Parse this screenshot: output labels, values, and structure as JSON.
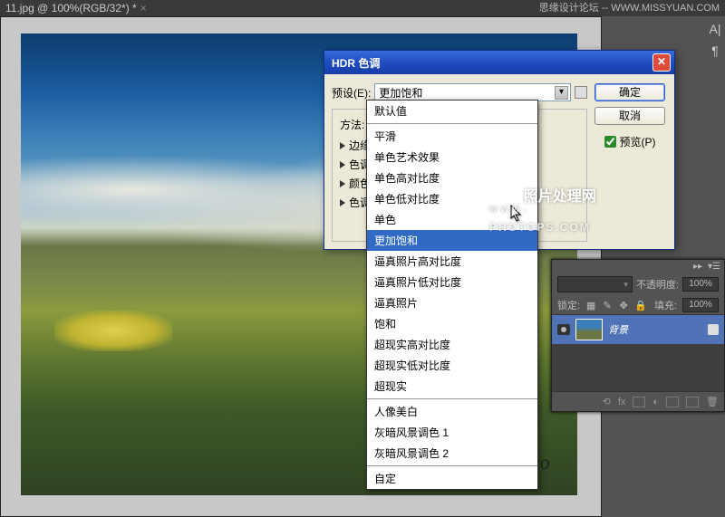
{
  "header_site": "思缘设计论坛 -- WWW.MISSYUAN.COM",
  "tab": {
    "title": "11.jpg @ 100%(RGB/32*) *",
    "close": "×"
  },
  "rail": {
    "a": "A|",
    "p": "¶"
  },
  "dialog": {
    "title": "HDR 色调",
    "preset_label": "预设(E):",
    "preset_value": "更加饱和",
    "method_label": "方法:",
    "sections": [
      "边缘",
      "色调",
      "颜色",
      "色调"
    ],
    "ok": "确定",
    "cancel": "取消",
    "preview": "预览(P)"
  },
  "dropdown": {
    "items_top": [
      "默认值"
    ],
    "items_mid": [
      "平滑",
      "单色艺术效果",
      "单色高对比度",
      "单色低对比度",
      "单色",
      "更加饱和",
      "逼真照片高对比度",
      "逼真照片低对比度",
      "逼真照片",
      "饱和",
      "超现实高对比度",
      "超现实低对比度",
      "超现实"
    ],
    "items_bot": [
      "人像美白",
      "灰暗风景调色 1",
      "灰暗风景调色 2"
    ],
    "items_last": [
      "自定"
    ],
    "selected": "更加饱和"
  },
  "watermark": {
    "cn": "照片处理网",
    "small": "www.",
    "big": "PHOTOPS.COM"
  },
  "signature": "Huoshanrizuo",
  "layers": {
    "opacity_label": "不透明度:",
    "opacity_val": "100%",
    "lock_label": "锁定:",
    "fill_label": "填充:",
    "fill_val": "100%",
    "layer_name": "背景"
  }
}
